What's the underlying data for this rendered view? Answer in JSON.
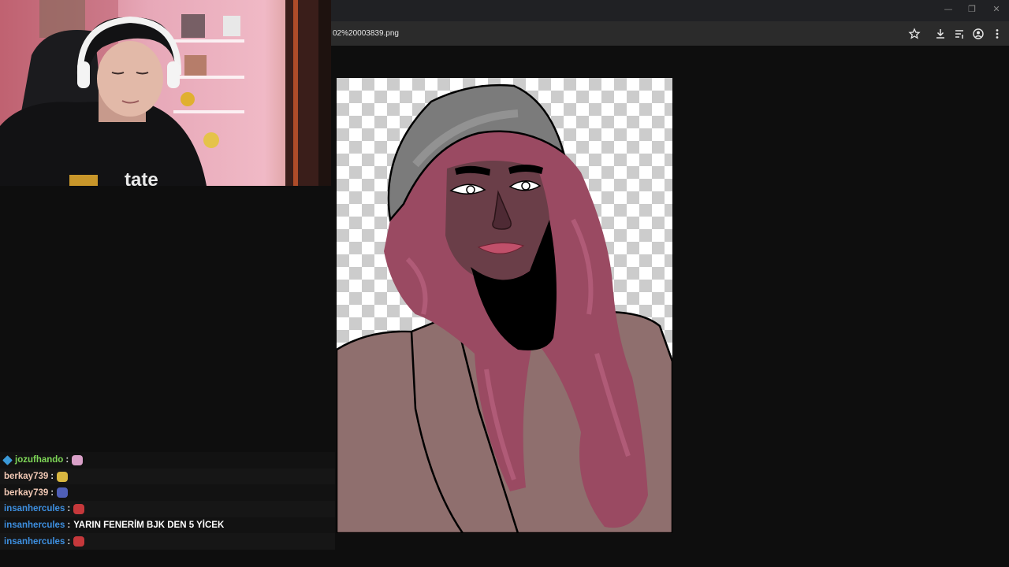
{
  "window": {
    "minimize_glyph": "—",
    "restore_glyph": "❐",
    "close_glyph": "✕"
  },
  "address_bar": {
    "url_text": "02%20003839.png"
  },
  "toolbar_icons": [
    "star-icon",
    "download-icon",
    "tab-search-icon",
    "profile-icon",
    "more-menu-icon"
  ],
  "stream_overlay": {
    "shirt_text": "tate"
  },
  "chat": {
    "messages": [
      {
        "user": "jozufhando",
        "user_color": "#7fd858",
        "has_badge": true,
        "text": "",
        "emote": "pink-creature-emote",
        "emote_color": "#d9a0c8"
      },
      {
        "user": "berkay739",
        "user_color": "#f2c9b5",
        "has_badge": false,
        "text": "",
        "emote": "yellow-bird-emote",
        "emote_color": "#d8b640"
      },
      {
        "user": "berkay739",
        "user_color": "#f2c9b5",
        "has_badge": false,
        "text": "",
        "emote": "blue-face-emote",
        "emote_color": "#4f5fb8"
      },
      {
        "user": "insanhercules",
        "user_color": "#3d8fe0",
        "has_badge": false,
        "text": "",
        "emote": "red-face-emote",
        "emote_color": "#c5383b"
      },
      {
        "user": "insanhercules",
        "user_color": "#3d8fe0",
        "has_badge": false,
        "text": "YARIN FENERİM BJK DEN 5 YİCEK",
        "emote": "",
        "emote_color": ""
      },
      {
        "user": "insanhercules",
        "user_color": "#3d8fe0",
        "has_badge": false,
        "text": "",
        "emote": "red-face-emote",
        "emote_color": "#c5383b"
      }
    ],
    "separator": ":"
  }
}
